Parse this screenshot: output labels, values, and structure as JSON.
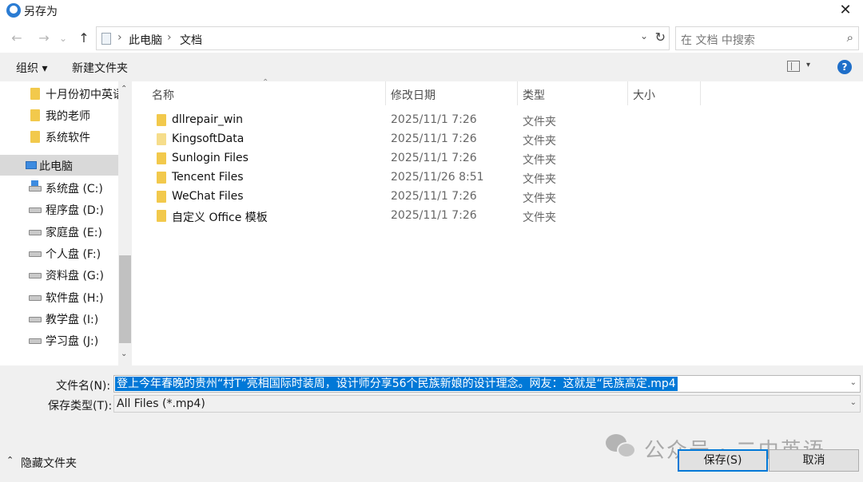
{
  "window": {
    "title": "另存为",
    "close_glyph": "✕"
  },
  "nav": {
    "back_glyph": "←",
    "forward_glyph": "→",
    "recent_glyph": "⌄",
    "up_glyph": "↑",
    "breadcrumb_sep": "›",
    "breadcrumbs": [
      "此电脑",
      "文档"
    ],
    "dropdown_glyph": "⌄",
    "refresh_glyph": "↻",
    "search_placeholder": "在 文档 中搜索",
    "search_glyph": "⌕"
  },
  "toolbar": {
    "organize": "组织 ▾",
    "new_folder": "新建文件夹",
    "view_caret": "▾",
    "help": "?"
  },
  "sidebar": {
    "items": [
      {
        "label": "十月份初中英语",
        "icon": "folder-icon"
      },
      {
        "label": "我的老师",
        "icon": "folder-icon"
      },
      {
        "label": "系统软件",
        "icon": "folder-icon"
      },
      {
        "label": "此电脑",
        "icon": "computer-icon"
      },
      {
        "label": "系统盘 (C:)",
        "icon": "system-drive-icon"
      },
      {
        "label": "程序盘 (D:)",
        "icon": "drive-icon"
      },
      {
        "label": "家庭盘 (E:)",
        "icon": "drive-icon"
      },
      {
        "label": "个人盘 (F:)",
        "icon": "drive-icon"
      },
      {
        "label": "资料盘 (G:)",
        "icon": "drive-icon"
      },
      {
        "label": "软件盘 (H:)",
        "icon": "drive-icon"
      },
      {
        "label": "教学盘 (I:)",
        "icon": "drive-icon"
      },
      {
        "label": "学习盘 (J:)",
        "icon": "drive-icon"
      }
    ],
    "scroll_up": "⌃",
    "scroll_down": "⌄"
  },
  "columns": {
    "name": "名称",
    "modified": "修改日期",
    "type": "类型",
    "size": "大小",
    "sort_glyph": "⌃"
  },
  "files": [
    {
      "name": "dllrepair_win",
      "modified": "2025/11/1 7:26",
      "type": "文件夹",
      "size": ""
    },
    {
      "name": "KingsoftData",
      "modified": "2025/11/1 7:26",
      "type": "文件夹",
      "size": ""
    },
    {
      "name": "Sunlogin Files",
      "modified": "2025/11/1 7:26",
      "type": "文件夹",
      "size": ""
    },
    {
      "name": "Tencent Files",
      "modified": "2025/11/26 8:51",
      "type": "文件夹",
      "size": ""
    },
    {
      "name": "WeChat Files",
      "modified": "2025/11/1 7:26",
      "type": "文件夹",
      "size": ""
    },
    {
      "name": "自定义 Office 模板",
      "modified": "2025/11/1 7:26",
      "type": "文件夹",
      "size": ""
    }
  ],
  "form": {
    "filename_label": "文件名(N):",
    "filename_value": "登上今年春晚的贵州“村T”亮相国际时装周，设计师分享56个民族新娘的设计理念。网友：这就是“民族高定.mp4",
    "filetype_label": "保存类型(T):",
    "filetype_value": "All Files (*.mp4)",
    "caret_glyph": "⌄"
  },
  "footer": {
    "hide_folders": "隐藏文件夹",
    "hide_glyph": "⌃",
    "save": "保存(S)",
    "cancel": "取消"
  },
  "watermark": {
    "text": "公众号 · 二中英语"
  },
  "colors": {
    "accent": "#0078d7",
    "folder": "#f2c94c",
    "selection_bg": "#d9d9d9",
    "chrome": "#f0f0f0"
  }
}
